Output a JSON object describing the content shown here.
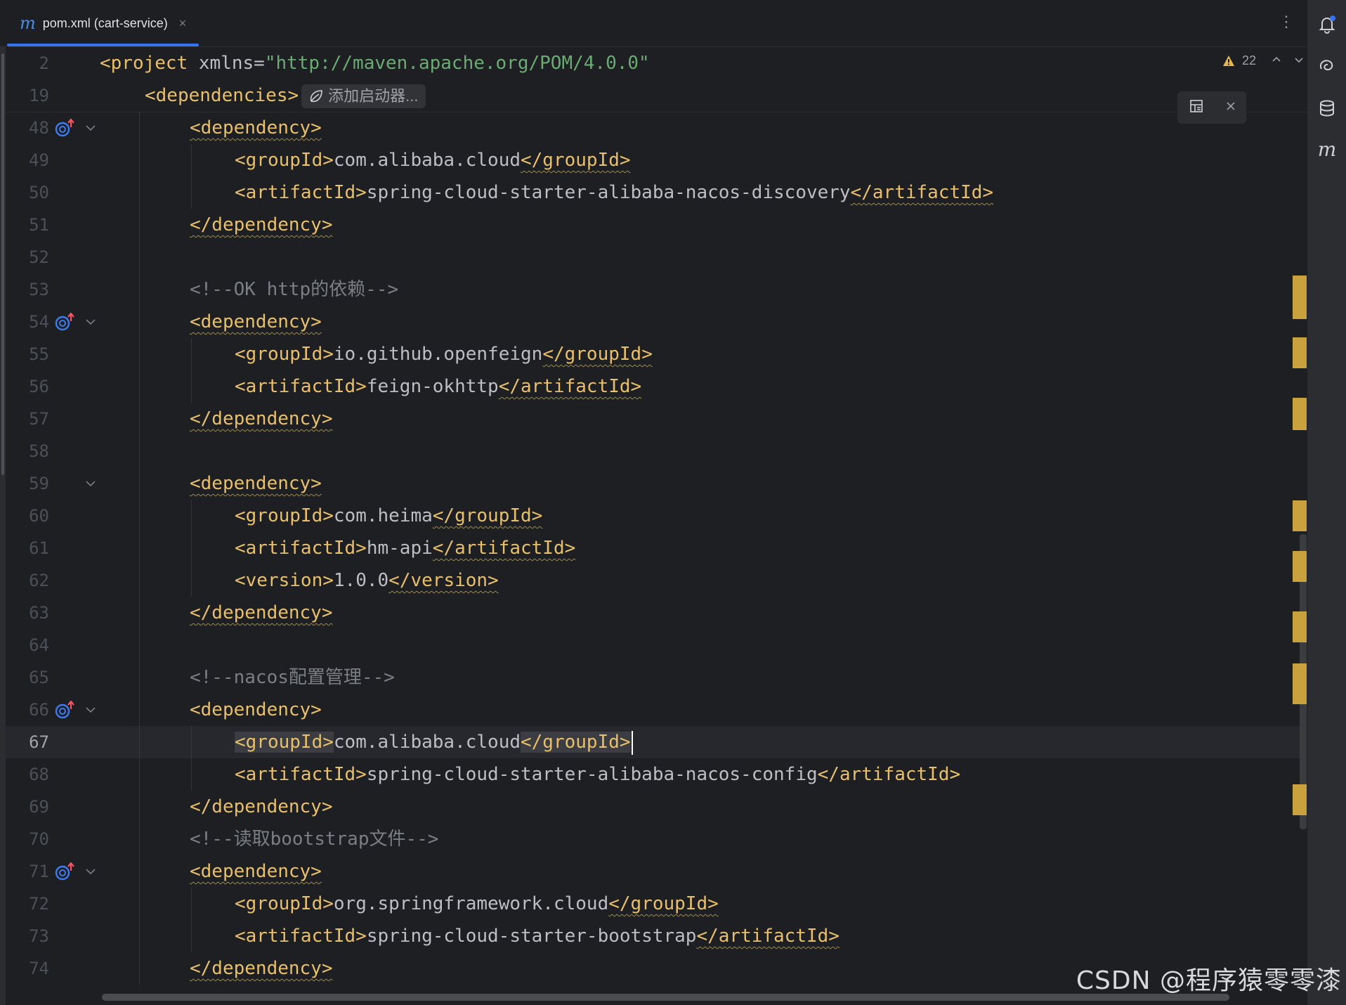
{
  "tab": {
    "icon": "maven-m-icon",
    "label": "pom.xml (cart-service)",
    "close": "×"
  },
  "more": "⋮",
  "problems": {
    "count": "22",
    "up": "^",
    "down": "v"
  },
  "sticky": [
    {
      "n": "2",
      "indent": 0,
      "parts": [
        {
          "t": "<project",
          "c": "tag"
        },
        {
          "t": " xmlns=",
          "c": "attr"
        },
        {
          "t": "\"http://maven.apache.org/POM/4.0.0\"",
          "c": "str"
        }
      ]
    },
    {
      "n": "19",
      "indent": 1,
      "parts": [
        {
          "t": "<dependencies>",
          "c": "tag"
        }
      ],
      "inlay": "添加启动器..."
    }
  ],
  "lines": [
    {
      "n": "48",
      "indent": 2,
      "icon": true,
      "fold": true,
      "parts": [
        {
          "t": "<dependency>",
          "c": "tag wavy"
        }
      ]
    },
    {
      "n": "49",
      "indent": 3,
      "parts": [
        {
          "t": "<groupId>",
          "c": "tag"
        },
        {
          "t": "com.alibaba.cloud",
          "c": "txt"
        },
        {
          "t": "</groupId>",
          "c": "tag wavy"
        }
      ]
    },
    {
      "n": "50",
      "indent": 3,
      "parts": [
        {
          "t": "<artifactId>",
          "c": "tag"
        },
        {
          "t": "spring-cloud-starter-alibaba-nacos-discovery",
          "c": "txt"
        },
        {
          "t": "</artifactId>",
          "c": "tag wavy"
        }
      ]
    },
    {
      "n": "51",
      "indent": 2,
      "parts": [
        {
          "t": "</dependency>",
          "c": "tag wavy"
        }
      ]
    },
    {
      "n": "52",
      "indent": 0,
      "parts": []
    },
    {
      "n": "53",
      "indent": 2,
      "parts": [
        {
          "t": "<!--OK http的依赖-->",
          "c": "comment"
        }
      ]
    },
    {
      "n": "54",
      "indent": 2,
      "icon": true,
      "fold": true,
      "parts": [
        {
          "t": "<dependency>",
          "c": "tag wavy"
        }
      ]
    },
    {
      "n": "55",
      "indent": 3,
      "parts": [
        {
          "t": "<groupId>",
          "c": "tag"
        },
        {
          "t": "io.github.openfeign",
          "c": "txt"
        },
        {
          "t": "</groupId>",
          "c": "tag wavy"
        }
      ]
    },
    {
      "n": "56",
      "indent": 3,
      "parts": [
        {
          "t": "<artifactId>",
          "c": "tag"
        },
        {
          "t": "feign-okhttp",
          "c": "txt"
        },
        {
          "t": "</artifactId>",
          "c": "tag wavy"
        }
      ]
    },
    {
      "n": "57",
      "indent": 2,
      "parts": [
        {
          "t": "</dependency>",
          "c": "tag wavy"
        }
      ]
    },
    {
      "n": "58",
      "indent": 0,
      "parts": []
    },
    {
      "n": "59",
      "indent": 2,
      "fold": true,
      "parts": [
        {
          "t": "<dependency>",
          "c": "tag wavy"
        }
      ]
    },
    {
      "n": "60",
      "indent": 3,
      "parts": [
        {
          "t": "<groupId>",
          "c": "tag"
        },
        {
          "t": "com.heima",
          "c": "txt"
        },
        {
          "t": "</groupId>",
          "c": "tag wavy"
        }
      ]
    },
    {
      "n": "61",
      "indent": 3,
      "parts": [
        {
          "t": "<artifactId>",
          "c": "tag"
        },
        {
          "t": "hm-api",
          "c": "txt"
        },
        {
          "t": "</artifactId>",
          "c": "tag wavy"
        }
      ]
    },
    {
      "n": "62",
      "indent": 3,
      "parts": [
        {
          "t": "<version>",
          "c": "tag"
        },
        {
          "t": "1.0.0",
          "c": "txt"
        },
        {
          "t": "</version>",
          "c": "tag wavy"
        }
      ]
    },
    {
      "n": "63",
      "indent": 2,
      "parts": [
        {
          "t": "</dependency>",
          "c": "tag wavy"
        }
      ]
    },
    {
      "n": "64",
      "indent": 0,
      "parts": []
    },
    {
      "n": "65",
      "indent": 2,
      "parts": [
        {
          "t": "<!--nacos配置管理-->",
          "c": "comment"
        }
      ]
    },
    {
      "n": "66",
      "indent": 2,
      "icon": true,
      "fold": true,
      "parts": [
        {
          "t": "<dependency>",
          "c": "tag"
        }
      ]
    },
    {
      "n": "67",
      "indent": 3,
      "current": true,
      "caret": true,
      "parts": [
        {
          "t": "<groupId>",
          "c": "tag matched"
        },
        {
          "t": "com.alibaba.cloud",
          "c": "txt"
        },
        {
          "t": "</groupId>",
          "c": "tag matched"
        }
      ]
    },
    {
      "n": "68",
      "indent": 3,
      "parts": [
        {
          "t": "<artifactId>",
          "c": "tag"
        },
        {
          "t": "spring-cloud-starter-alibaba-nacos-config",
          "c": "txt"
        },
        {
          "t": "</artifactId>",
          "c": "tag"
        }
      ]
    },
    {
      "n": "69",
      "indent": 2,
      "parts": [
        {
          "t": "</dependency>",
          "c": "tag"
        }
      ]
    },
    {
      "n": "70",
      "indent": 2,
      "parts": [
        {
          "t": "<!--读取bootstrap文件-->",
          "c": "comment"
        }
      ]
    },
    {
      "n": "71",
      "indent": 2,
      "icon": true,
      "fold": true,
      "parts": [
        {
          "t": "<dependency>",
          "c": "tag wavy"
        }
      ]
    },
    {
      "n": "72",
      "indent": 3,
      "parts": [
        {
          "t": "<groupId>",
          "c": "tag"
        },
        {
          "t": "org.springframework.cloud",
          "c": "txt"
        },
        {
          "t": "</groupId>",
          "c": "tag wavy"
        }
      ]
    },
    {
      "n": "73",
      "indent": 3,
      "parts": [
        {
          "t": "<artifactId>",
          "c": "tag"
        },
        {
          "t": "spring-cloud-starter-bootstrap",
          "c": "txt"
        },
        {
          "t": "</artifactId>",
          "c": "tag wavy"
        }
      ]
    },
    {
      "n": "74",
      "indent": 2,
      "parts": [
        {
          "t": "</dependency>",
          "c": "tag wavy"
        }
      ]
    }
  ],
  "watermark": "CSDN @程序猿零零漆",
  "colors": {
    "accent": "#3574f0",
    "tag": "#e8bf6a",
    "comment": "#7a7e85",
    "string": "#6aab73",
    "marker": "#c9a13d"
  },
  "right_icons": [
    "notifications-icon",
    "ai-assistant-icon",
    "database-icon",
    "maven-icon"
  ]
}
